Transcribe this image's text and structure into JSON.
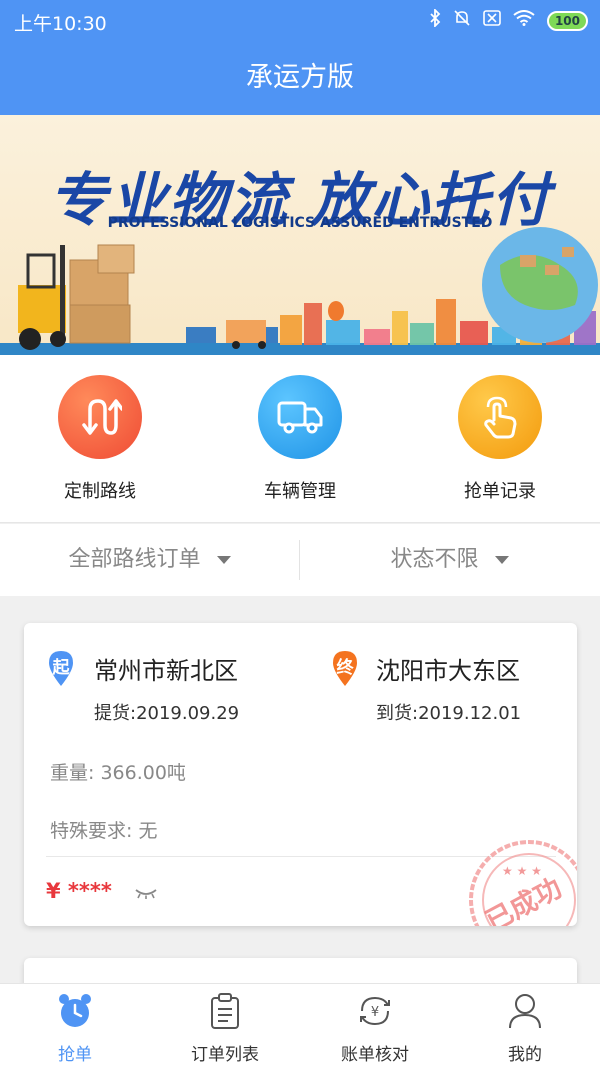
{
  "status_bar": {
    "time": "上午10:30",
    "battery": "100"
  },
  "header": {
    "title": "承运方版"
  },
  "banner": {
    "headline": "专业物流 放心托付",
    "subtitle": "PROFESSIONAL LOGISTICS ASSURED ENTRUSTED"
  },
  "quick_actions": [
    {
      "label": "定制路线",
      "icon": "route-icon",
      "color": "#f05a3a"
    },
    {
      "label": "车辆管理",
      "icon": "truck-icon",
      "color": "#2ea0ee"
    },
    {
      "label": "抢单记录",
      "icon": "tap-hand-icon",
      "color": "#f5a10f"
    }
  ],
  "filters": {
    "route": "全部路线订单",
    "status": "状态不限"
  },
  "order": {
    "origin_badge": "起",
    "origin_city": "常州市新北区",
    "pickup": "提货:2019.09.29",
    "dest_badge": "终",
    "dest_city": "沈阳市大东区",
    "delivery": "到货:2019.12.01",
    "weight": "重量: 366.00吨",
    "requirements": "特殊要求: 无",
    "price": "¥ ****",
    "stamp": "已成功"
  },
  "tabs": [
    {
      "label": "抢单",
      "icon": "alarm-clock-icon"
    },
    {
      "label": "订单列表",
      "icon": "clipboard-icon"
    },
    {
      "label": "账单核对",
      "icon": "yen-refresh-icon"
    },
    {
      "label": "我的",
      "icon": "user-icon"
    }
  ],
  "colors": {
    "primary": "#4f94f4",
    "price_red": "#e8383d",
    "origin_blue": "#4f94f4",
    "dest_orange": "#f4731f"
  }
}
